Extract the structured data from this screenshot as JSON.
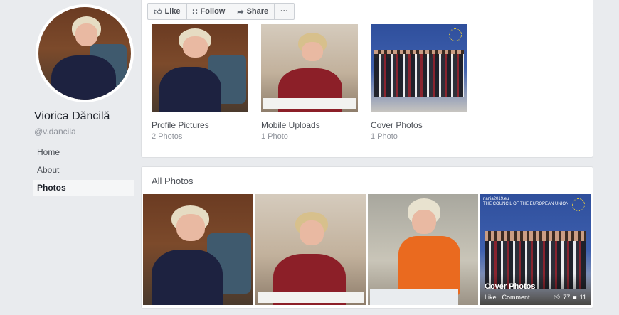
{
  "profile": {
    "name": "Viorica Dăncilă",
    "handle": "@v.dancila"
  },
  "nav": [
    {
      "label": "Home",
      "active": false
    },
    {
      "label": "About",
      "active": false
    },
    {
      "label": "Photos",
      "active": true
    }
  ],
  "actions": {
    "like": "Like",
    "follow": "Follow",
    "share": "Share",
    "more": "···"
  },
  "albums": [
    {
      "title": "Profile Pictures",
      "count": "2 Photos"
    },
    {
      "title": "Mobile Uploads",
      "count": "1 Photo"
    },
    {
      "title": "Cover Photos",
      "count": "1 Photo"
    }
  ],
  "all_photos": {
    "title": "All Photos",
    "banner": "nania2019.eu\nTHE COUNCIL OF THE EUROPEAN UNION",
    "overlay": {
      "title": "Cover Photos",
      "sub": "Like · Comment",
      "likes": "77",
      "comments": "11"
    }
  },
  "icons": {
    "like": "thumbs-up-icon",
    "follow": "rss-icon",
    "share": "share-arrow-icon",
    "more": "ellipsis-icon"
  }
}
